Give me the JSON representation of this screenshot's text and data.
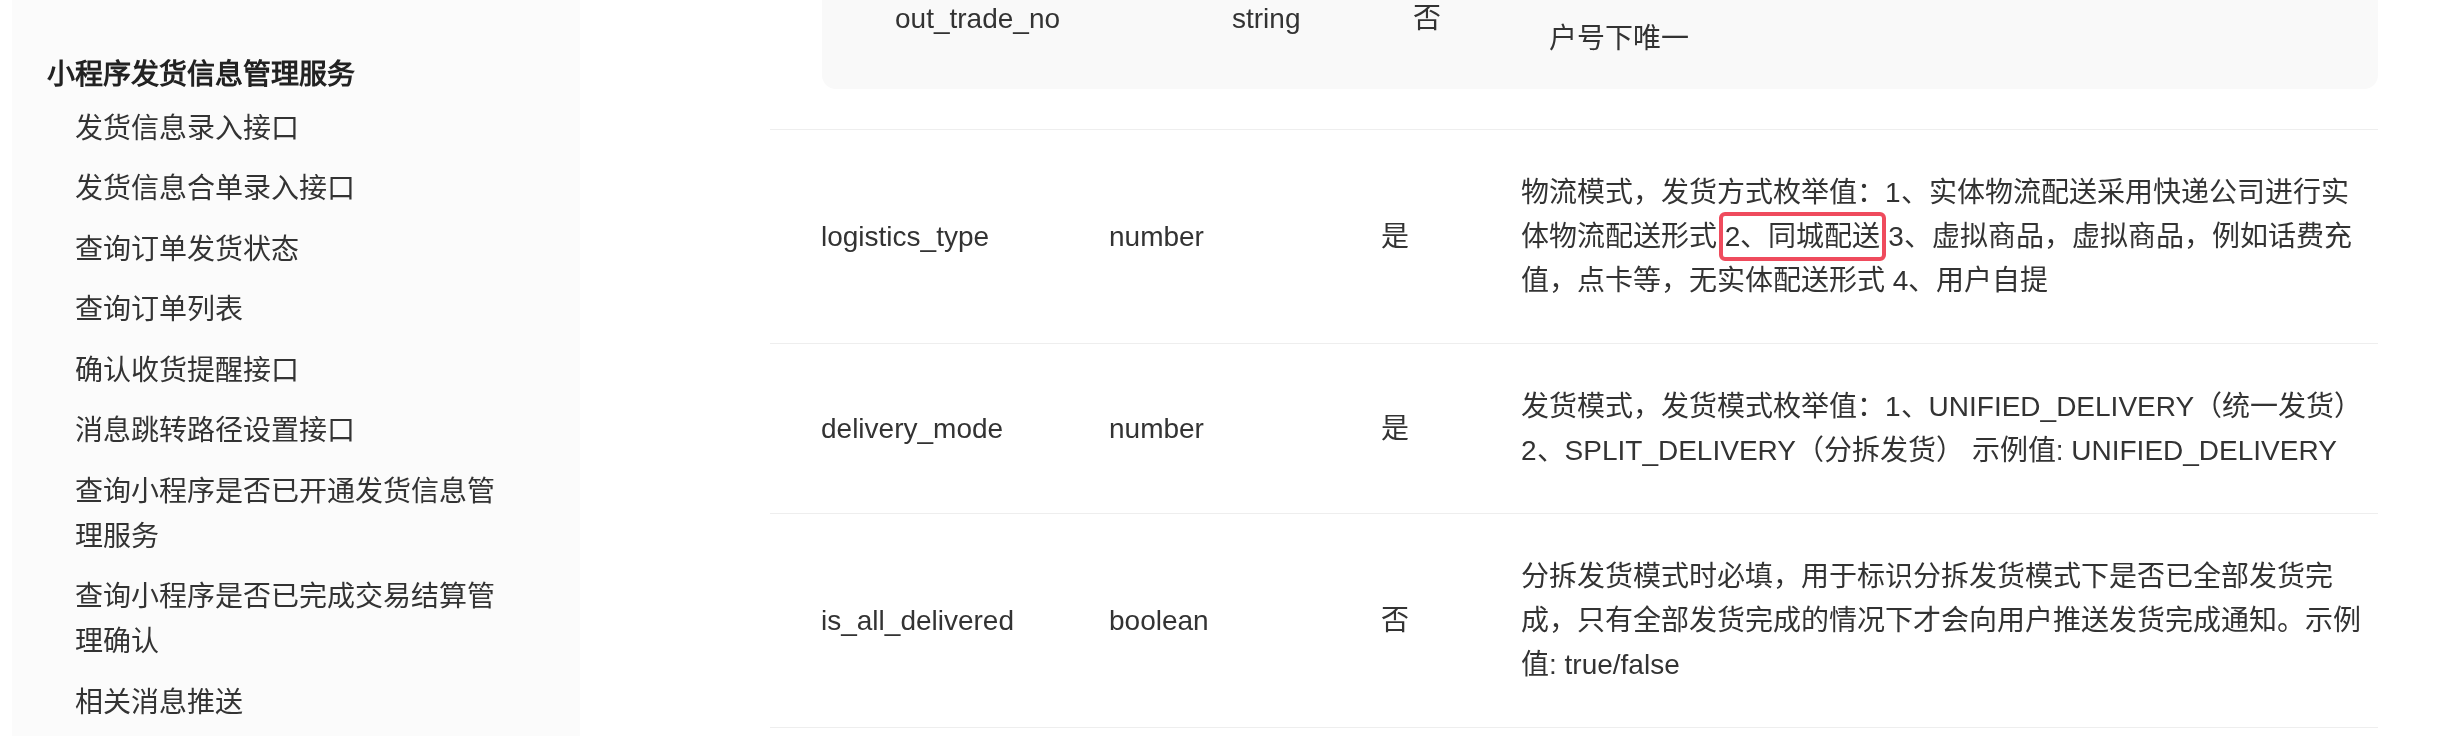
{
  "sidebar": {
    "sections": [
      {
        "title": "小程序发货信息管理服务",
        "children": [
          {
            "label": "发货信息录入接口"
          },
          {
            "label": "发货信息合单录入接口"
          },
          {
            "label": "查询订单发货状态"
          },
          {
            "label": "查询订单列表"
          },
          {
            "label": "确认收货提醒接口"
          },
          {
            "label": "消息跳转路径设置接口"
          },
          {
            "label": "查询小程序是否已开通发货信息管理服务"
          },
          {
            "label": "查询小程序是否已完成交易结算管理确认"
          },
          {
            "label": "相关消息推送"
          }
        ]
      }
    ]
  },
  "parameters_table": {
    "rows": [
      {
        "kind": "nested",
        "rows": [
          {
            "name": "out_trade_no",
            "type": "string",
            "required": "否",
            "description": [
              {
                "text": "户号下唯一",
                "annotated": false
              }
            ]
          }
        ]
      },
      {
        "kind": "param",
        "name": "logistics_type",
        "type": "number",
        "required": "是",
        "description": [
          {
            "text": "物流模式，发货方式枚举值：1、实体物流配送采用快递公司进行实体物流配送形式 ",
            "annotated": false
          },
          {
            "text": "2、同城配送",
            "annotated": true
          },
          {
            "text": " 3、虚拟商品，虚拟商品，例如话费充值，点卡等，无实体配送形式 4、用户自提",
            "annotated": false
          }
        ]
      },
      {
        "kind": "param",
        "name": "delivery_mode",
        "type": "number",
        "required": "是",
        "description": [
          {
            "text": "发货模式，发货模式枚举值：1、UNIFIED_DELIVERY（统一发货）2、SPLIT_DELIVERY（分拆发货） 示例值: UNIFIED_DELIVERY",
            "annotated": false
          }
        ]
      },
      {
        "kind": "param",
        "name": "is_all_delivered",
        "type": "boolean",
        "required": "否",
        "description": [
          {
            "text": "分拆发货模式时必填，用于标识分拆发货模式下是否已全部发货完成，只有全部发货完成的情况下才会向用户推送发货完成通知。示例值: true/false",
            "annotated": false
          }
        ]
      }
    ]
  }
}
